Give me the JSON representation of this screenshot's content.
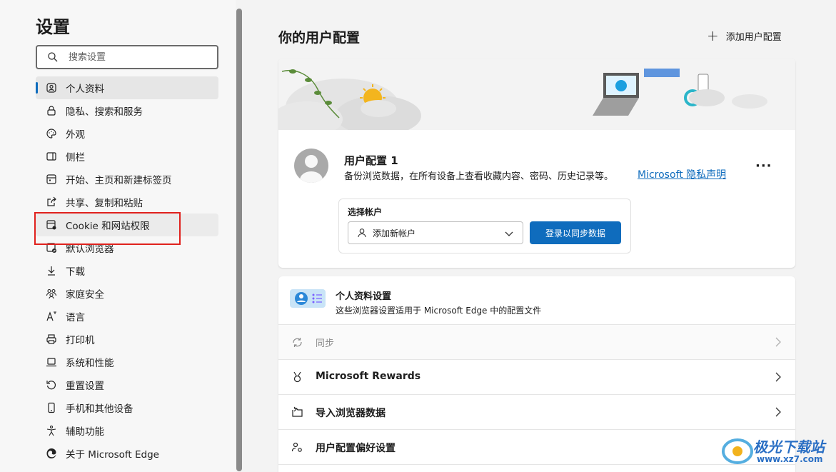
{
  "sidebar": {
    "title": "设置",
    "search_placeholder": "搜索设置",
    "items": [
      {
        "label": "个人资料",
        "icon": "profile-icon"
      },
      {
        "label": "隐私、搜索和服务",
        "icon": "lock-icon"
      },
      {
        "label": "外观",
        "icon": "palette-icon"
      },
      {
        "label": "侧栏",
        "icon": "sidebar-icon"
      },
      {
        "label": "开始、主页和新建标签页",
        "icon": "home-tabs-icon"
      },
      {
        "label": "共享、复制和粘贴",
        "icon": "share-icon"
      },
      {
        "label": "Cookie 和网站权限",
        "icon": "cookie-site-icon"
      },
      {
        "label": "默认浏览器",
        "icon": "default-browser-icon"
      },
      {
        "label": "下载",
        "icon": "download-icon"
      },
      {
        "label": "家庭安全",
        "icon": "family-icon"
      },
      {
        "label": "语言",
        "icon": "language-icon"
      },
      {
        "label": "打印机",
        "icon": "printer-icon"
      },
      {
        "label": "系统和性能",
        "icon": "laptop-icon"
      },
      {
        "label": "重置设置",
        "icon": "reset-icon"
      },
      {
        "label": "手机和其他设备",
        "icon": "phone-icon"
      },
      {
        "label": "辅助功能",
        "icon": "accessibility-icon"
      },
      {
        "label": "关于 Microsoft Edge",
        "icon": "edge-icon"
      }
    ]
  },
  "main": {
    "title": "你的用户配置",
    "add_profile": "添加用户配置",
    "profile": {
      "name": "用户配置 1",
      "description": "备份浏览数据，在所有设备上查看收藏内容、密码、历史记录等。",
      "privacy_link": "Microsoft 隐私声明",
      "more": "···"
    },
    "account": {
      "label": "选择帐户",
      "selected": "添加新帐户",
      "sync_button": "登录以同步数据"
    },
    "profile_settings": {
      "title": "个人资料设置",
      "description": "这些浏览器设置适用于 Microsoft Edge 中的配置文件"
    },
    "rows": [
      {
        "label": "同步",
        "icon": "sync-icon",
        "disabled": true
      },
      {
        "label": "Microsoft Rewards",
        "icon": "medal-icon",
        "disabled": false
      },
      {
        "label": "导入浏览器数据",
        "icon": "import-icon",
        "disabled": false
      },
      {
        "label": "用户配置偏好设置",
        "icon": "people-settings-icon",
        "disabled": false
      }
    ]
  },
  "watermark": {
    "text": "极光下载站",
    "url": "www.xz7.com"
  },
  "colors": {
    "accent": "#0f6cbd",
    "highlight": "#e0211d"
  }
}
